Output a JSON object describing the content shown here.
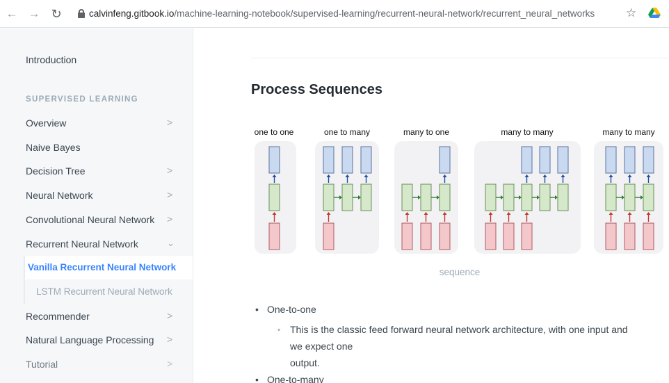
{
  "browser": {
    "url_domain": "calvinfeng.gitbook.io",
    "url_path": "/machine-learning-notebook/supervised-learning/recurrent-neural-network/recurrent_neural_networks",
    "back_icon": "arrow-left-icon",
    "forward_icon": "arrow-right-icon",
    "reload_icon": "reload-icon",
    "bookmark_icon": "star-icon"
  },
  "sidebar": {
    "intro": "Introduction",
    "section_title": "SUPERVISED LEARNING",
    "items": [
      {
        "label": "Overview"
      },
      {
        "label": "Naive Bayes"
      },
      {
        "label": "Decision Tree"
      },
      {
        "label": "Neural Network"
      },
      {
        "label": "Convolutional Neural Network"
      },
      {
        "label": "Recurrent Neural Network"
      },
      {
        "label": "Vanilla Recurrent Neural Network"
      },
      {
        "label": "LSTM Recurrent Neural Network"
      },
      {
        "label": "Recommender"
      },
      {
        "label": "Natural Language Processing"
      },
      {
        "label": "Tutorial"
      }
    ]
  },
  "main": {
    "heading": "Process Sequences",
    "diagram_titles": [
      "one to one",
      "one to many",
      "many to one",
      "many to many",
      "many to many"
    ],
    "caption": "sequence",
    "bullet1": "One-to-one",
    "bullet1_sub_line1": "This is the classic feed forward neural network architecture, with one input and",
    "bullet1_sub_line2": "we expect one",
    "bullet1_sub_line3": "output.",
    "bullet2": "One-to-many"
  },
  "colors": {
    "accent": "#3884ff",
    "input_box": "#f4c7cb",
    "hidden_box": "#d5e8c9",
    "output_box": "#c9d9f0",
    "arrow_input": "#c0392b",
    "arrow_hidden": "#2e7d32",
    "arrow_output": "#1f4e9c"
  }
}
